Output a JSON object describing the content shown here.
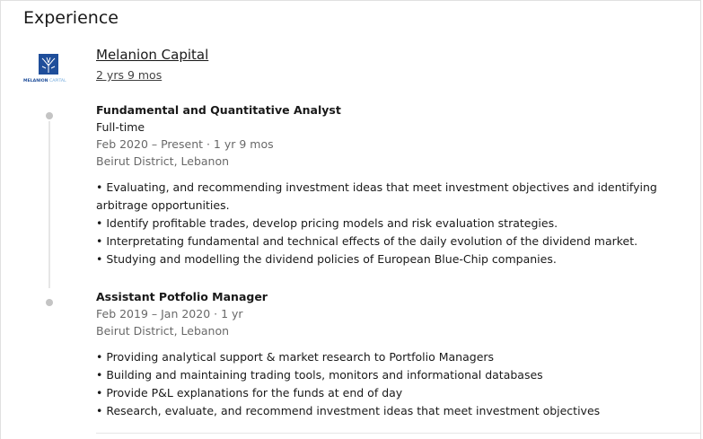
{
  "section": {
    "title": "Experience"
  },
  "company": {
    "name": "Melanion Capital",
    "duration": "2 yrs 9 mos",
    "logo_text_left": "MELANION",
    "logo_text_right": "CAPITAL",
    "logo_color": "#1f4e9a"
  },
  "roles": [
    {
      "title": "Fundamental and Quantitative Analyst",
      "employment_type": "Full-time",
      "dates": "Feb 2020 – Present · 1 yr 9 mos",
      "location": "Beirut District, Lebanon",
      "description": [
        "• Evaluating, and recommending investment ideas that meet investment objectives and identifying arbitrage opportunities.",
        "• Identify profitable trades, develop pricing models and risk evaluation strategies.",
        "• Interpretating fundamental and technical effects of the daily evolution of the dividend market.",
        "• Studying and modelling the dividend policies of European Blue-Chip companies."
      ]
    },
    {
      "title": "Assistant Potfolio Manager",
      "dates": "Feb 2019 – Jan 2020 · 1 yr",
      "location": "Beirut District, Lebanon",
      "description": [
        "• Providing analytical support & market research to Portfolio Managers",
        "• Building and maintaining trading tools, monitors and informational databases",
        "• Provide P&L explanations for the funds at end of day",
        "• Research, evaluate, and recommend investment ideas that meet investment objectives"
      ]
    }
  ]
}
